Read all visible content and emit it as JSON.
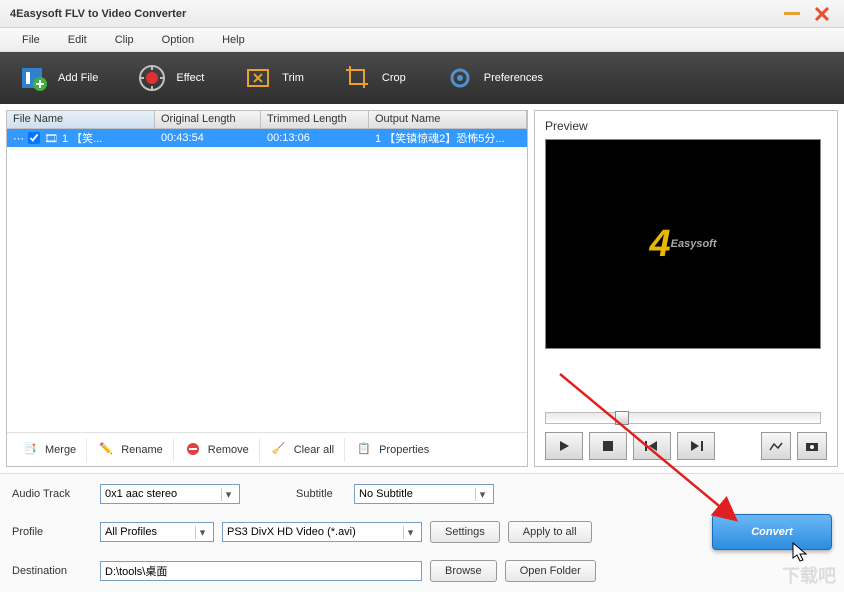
{
  "window": {
    "title": "4Easysoft FLV to Video Converter"
  },
  "menu": {
    "file": "File",
    "edit": "Edit",
    "clip": "Clip",
    "option": "Option",
    "help": "Help"
  },
  "toolbar": {
    "addfile": "Add File",
    "effect": "Effect",
    "trim": "Trim",
    "crop": "Crop",
    "preferences": "Preferences"
  },
  "list": {
    "headers": {
      "filename": "File Name",
      "original": "Original Length",
      "trimmed": "Trimmed Length",
      "output": "Output Name"
    },
    "rows": [
      {
        "filename": "1 【笑...",
        "original": "00:43:54",
        "trimmed": "00:13:06",
        "output": "1 【笑镇惊魂2】恐怖5分..."
      }
    ]
  },
  "filebtns": {
    "merge": "Merge",
    "rename": "Rename",
    "remove": "Remove",
    "clearall": "Clear all",
    "properties": "Properties"
  },
  "preview": {
    "label": "Preview",
    "logo": "Easysoft"
  },
  "settings": {
    "audiotrack_label": "Audio Track",
    "audiotrack_value": "0x1 aac stereo",
    "subtitle_label": "Subtitle",
    "subtitle_value": "No Subtitle",
    "profile_label": "Profile",
    "profile_filter": "All Profiles",
    "profile_value": "PS3 DivX HD Video (*.avi)",
    "settings_btn": "Settings",
    "applyall_btn": "Apply to all",
    "destination_label": "Destination",
    "destination_value": "D:\\tools\\桌面",
    "browse_btn": "Browse",
    "openfolder_btn": "Open Folder",
    "convert_btn": "Convert"
  },
  "watermark": "下载吧"
}
